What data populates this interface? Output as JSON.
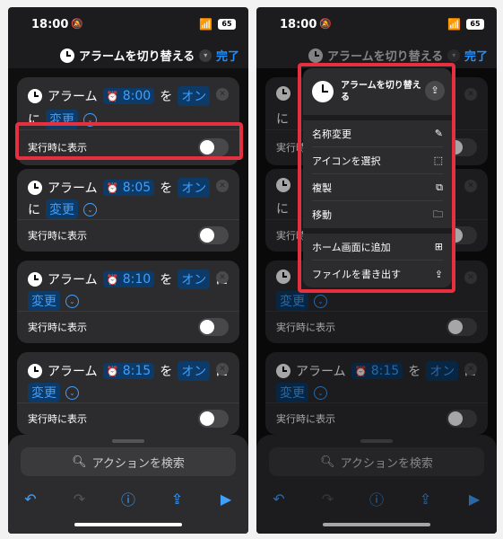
{
  "status": {
    "time": "18:00",
    "battery": "65"
  },
  "nav": {
    "title": "アラームを切り替える",
    "done": "完了"
  },
  "cards": [
    {
      "alarm": "アラーム",
      "time": "8:00",
      "wo": "を",
      "state": "オン",
      "ni": "に",
      "change": "変更",
      "show": "実行時に表示"
    },
    {
      "alarm": "アラーム",
      "time": "8:05",
      "wo": "を",
      "state": "オン",
      "ni": "に",
      "change": "変更",
      "show": "実行時に表示"
    },
    {
      "alarm": "アラーム",
      "time": "8:10",
      "wo": "を",
      "state": "オン",
      "ni": "に",
      "change": "変更",
      "show": "実行時に表示"
    },
    {
      "alarm": "アラーム",
      "time": "8:15",
      "wo": "を",
      "state": "オン",
      "ni": "に",
      "change": "変更",
      "show": "実行時に表示"
    }
  ],
  "search": {
    "placeholder": "アクションを検索"
  },
  "menu": {
    "title": "アラームを切り替える",
    "items": [
      {
        "label": "名称変更",
        "icon": "pencil-icon"
      },
      {
        "label": "アイコンを選択",
        "icon": "dashed-square-icon"
      },
      {
        "label": "複製",
        "icon": "duplicate-icon"
      },
      {
        "label": "移動",
        "icon": "folder-icon"
      },
      {
        "label": "ホーム画面に追加",
        "icon": "add-square-icon"
      },
      {
        "label": "ファイルを書き出す",
        "icon": "export-icon"
      }
    ]
  },
  "colors": {
    "accent": "#3ea0ff",
    "highlight": "#e5303f",
    "background": "#1c1c1e"
  }
}
